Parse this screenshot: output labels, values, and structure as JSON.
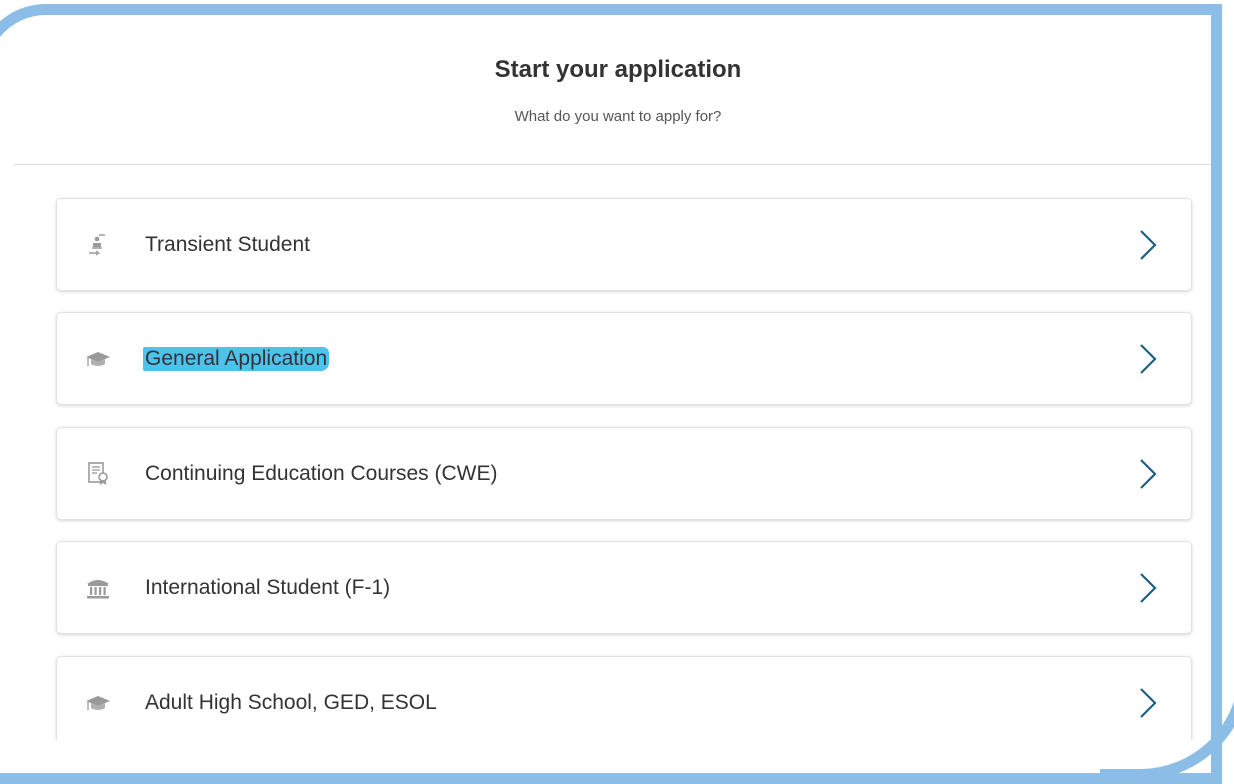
{
  "header": {
    "title": "Start your application",
    "subtitle": "What do you want to apply for?"
  },
  "options": [
    {
      "label": "",
      "icon": "hidden-option-icon"
    },
    {
      "label": "Transient Student",
      "icon": "transfer-student-icon"
    },
    {
      "label": "General Application",
      "icon": "graduation-cap-icon",
      "highlighted": true
    },
    {
      "label": "Continuing Education Courses (CWE)",
      "icon": "certificate-icon"
    },
    {
      "label": "International Student (F-1)",
      "icon": "institution-building-icon"
    },
    {
      "label": "Adult High School, GED, ESOL",
      "icon": "graduation-cap-icon"
    }
  ],
  "colors": {
    "chevron": "#1f5f80",
    "highlight": "#4cc2ec",
    "frame": "#8cbde6",
    "icon": "#9a9a9a"
  }
}
